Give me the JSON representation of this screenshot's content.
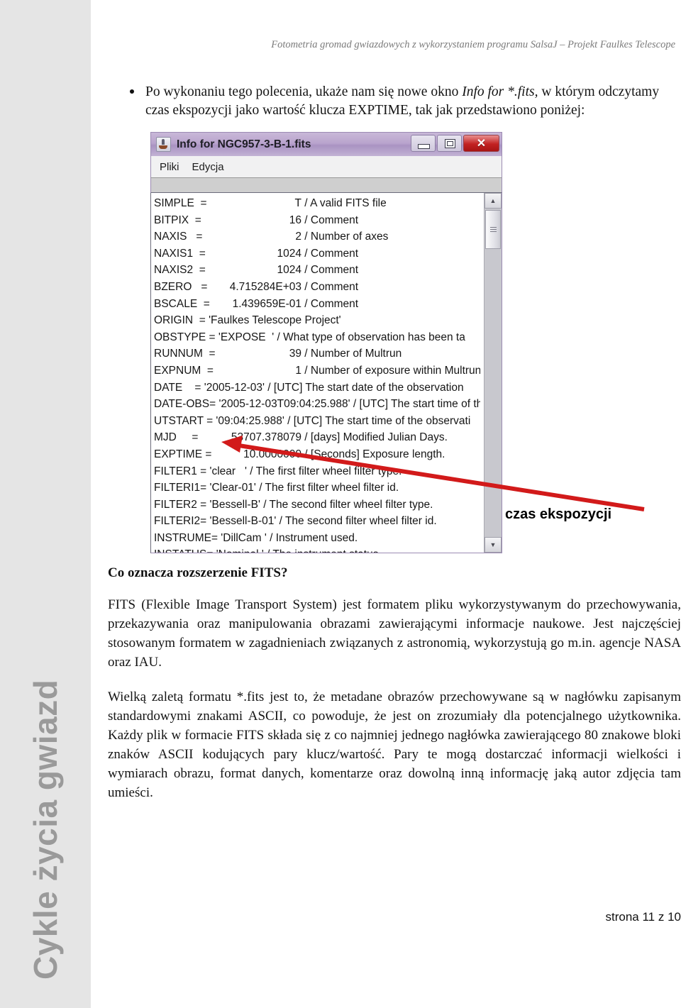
{
  "header": {
    "running_title": "Fotometria gromad gwiazdowych z wykorzystaniem programu SalsaJ – Projekt Faulkes Telescope"
  },
  "sidebar": {
    "vertical_label": "Cykle życia gwiazd"
  },
  "intro": {
    "bullet_part1": "Po wykonaniu tego polecenia, ukaże nam się nowe okno ",
    "bullet_italic": "Info for *.fits,",
    "bullet_part2": " w którym odczytamy czas ekspozycji jako wartość klucza EXPTIME, tak jak przedstawiono poniżej:"
  },
  "fits_window": {
    "title": "Info for NGC957-3-B-1.fits",
    "app_icon": "java-coffee-icon",
    "window_buttons": {
      "minimize": "minimize-icon",
      "maximize": "maximize-icon",
      "close": "✕"
    },
    "menus": [
      "Pliki",
      "Edycja"
    ],
    "scrollbar": {
      "up_arrow": "▲",
      "down_arrow": "▼"
    },
    "lines": [
      {
        "key": "SIMPLE  =",
        "value": "T",
        "comment": "/ A valid FITS file"
      },
      {
        "key": "BITPIX  =",
        "value": "16",
        "comment": "/ Comment"
      },
      {
        "key": "NAXIS   =",
        "value": "2",
        "comment": "/ Number of axes"
      },
      {
        "key": "NAXIS1  =",
        "value": "1024",
        "comment": "/ Comment"
      },
      {
        "key": "NAXIS2  =",
        "value": "1024",
        "comment": "/ Comment"
      },
      {
        "key": "BZERO   =",
        "value": "4.715284E+03",
        "comment": "/ Comment"
      },
      {
        "key": "BSCALE  =",
        "value": "1.439659E-01",
        "comment": "/ Comment"
      },
      {
        "key": "ORIGIN  = 'Faulkes Telescope Project'",
        "value": "",
        "comment": ""
      },
      {
        "key": "OBSTYPE = 'EXPOSE  '",
        "value": "",
        "comment": "/ What type of observation has been ta"
      },
      {
        "key": "RUNNUM  =",
        "value": "39",
        "comment": "/ Number of Multrun"
      },
      {
        "key": "EXPNUM  =",
        "value": "1",
        "comment": "/ Number of exposure within Multrun"
      },
      {
        "key": "DATE    = '2005-12-03'",
        "value": "",
        "comment": "/ [UTC] The start date of the observation"
      },
      {
        "key": "DATE-OBS= '2005-12-03T09:04:25.988'",
        "value": "",
        "comment": "/ [UTC] The start time of the"
      },
      {
        "key": "UTSTART = '09:04:25.988'",
        "value": "",
        "comment": "/ [UTC] The start time of the observati"
      },
      {
        "key": "MJD     =",
        "value": "53707.378079",
        "comment": "/ [days] Modified Julian Days."
      },
      {
        "key": "EXPTIME =",
        "value": "10.0000000",
        "comment": "/ [Seconds] Exposure length."
      },
      {
        "key": "FILTER1 = 'clear   '",
        "value": "",
        "comment": "/ The first filter wheel filter type."
      },
      {
        "key": "FILTERI1= 'Clear-01'",
        "value": "",
        "comment": "/ The first filter wheel filter id."
      },
      {
        "key": "FILTER2 = 'Bessell-B'",
        "value": "",
        "comment": "/ The second filter wheel filter type."
      },
      {
        "key": "FILTERI2= 'Bessell-B-01'",
        "value": "",
        "comment": "/ The second filter wheel filter id."
      },
      {
        "key": "INSTRUME= 'DillCam '",
        "value": "",
        "comment": "/ Instrument used."
      },
      {
        "key": "INSTATUS= 'Nominal '",
        "value": "",
        "comment": "/ The instrument status."
      }
    ]
  },
  "annotation": {
    "label": "czas ekspozycji",
    "color": "#d21a1a"
  },
  "article": {
    "heading": "Co oznacza rozszerzenie FITS?",
    "paragraphs": [
      "FITS (Flexible Image Transport System) jest formatem pliku wykorzystywanym do przechowywania, przekazywania oraz manipulowania obrazami zawierającymi informacje naukowe. Jest najczęściej stosowanym formatem w zagadnieniach związanych z astronomią, wykorzystują go m.in. agencje NASA oraz IAU.",
      "Wielką zaletą formatu *.fits jest to, że metadane obrazów przechowywane są w nagłówku zapisanym standardowymi znakami ASCII, co powoduje, że jest on zrozumiały dla potencjalnego użytkownika. Każdy plik w formacie FITS składa się z co najmniej jednego nagłówka zawierającego 80 znakowe bloki znaków ASCII kodujących pary klucz/wartość. Pary te mogą dostarczać informacji wielkości i wymiarach obrazu, format danych, komentarze oraz dowolną inną informację jaką autor zdjęcia tam umieści."
    ]
  },
  "footer": {
    "page_label": "strona 11 z 10"
  }
}
